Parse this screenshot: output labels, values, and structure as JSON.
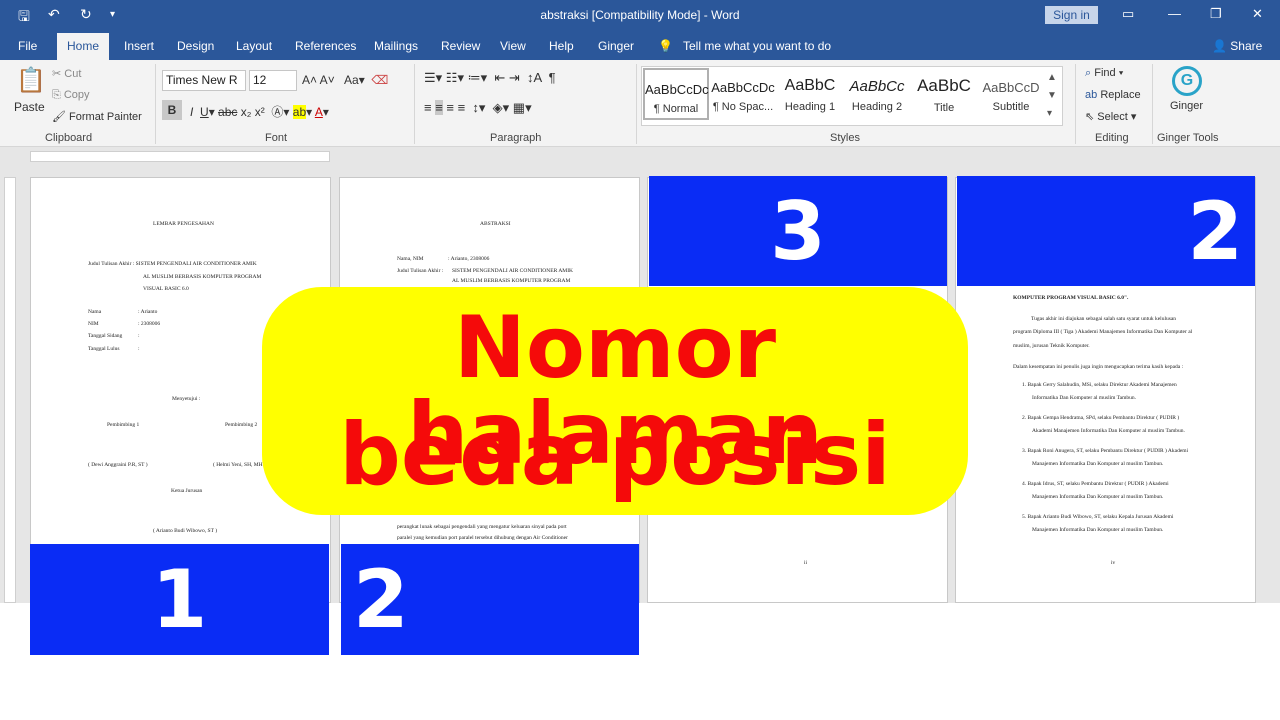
{
  "app": {
    "title": "abstraksi [Compatibility Mode] - Word",
    "signin": "Sign in"
  },
  "tabs": [
    "File",
    "Home",
    "Insert",
    "Design",
    "Layout",
    "References",
    "Mailings",
    "Review",
    "View",
    "Help",
    "Ginger"
  ],
  "tell_me": "Tell me what you want to do",
  "share": "Share",
  "ribbon": {
    "clipboard": {
      "paste": "Paste",
      "cut": "Cut",
      "copy": "Copy",
      "format_painter": "Format Painter",
      "label": "Clipboard"
    },
    "font": {
      "name": "Times New R",
      "size": "12",
      "label": "Font"
    },
    "paragraph": {
      "label": "Paragraph"
    },
    "styles": {
      "items": [
        {
          "preview": "AaBbCcDc",
          "name": "¶ Normal"
        },
        {
          "preview": "AaBbCcDc",
          "name": "¶ No Spac..."
        },
        {
          "preview": "AaBbC",
          "name": "Heading 1"
        },
        {
          "preview": "AaBbCc",
          "name": "Heading 2"
        },
        {
          "preview": "AaBbC",
          "name": "Title"
        },
        {
          "preview": "AaBbCcD",
          "name": "Subtitle"
        }
      ],
      "label": "Styles"
    },
    "editing": {
      "find": "Find",
      "replace": "Replace",
      "select": "Select",
      "label": "Editing"
    },
    "ginger": {
      "name": "Ginger",
      "label": "Ginger Tools"
    }
  },
  "pages": [
    {
      "lines": [
        "LEMBAR PENGESAHAN",
        "Judul Tulisan Akhir : SISTEM PENGENDALI AIR CONDITIONER AMIK",
        "AL MUSLIM BERBASIS KOMPUTER PROGRAM",
        "VISUAL BASIC 6.0",
        "Nama",
        ": Arianto",
        "NIM",
        ": 2308006",
        "Tanggal Sidang",
        ":",
        "Tanggal Lulus",
        ":",
        "Menyetujui :",
        "Pembimbing 1",
        "Pembimbing 2",
        "( Dewi Anggraini P.R, ST )",
        "( Helmi Yeni, SH, MH )",
        "Ketua Jurusan",
        "( Arianto Budi Wibowo, ST )"
      ],
      "number": "1"
    },
    {
      "lines": [
        "ABSTRAKSI",
        "Nama, NIM",
        ": Arianto, 2308006",
        "Judul Tulisan Akhir :",
        "SISTEM PENGENDALI AIR CONDITIONER AMIK",
        "AL MUSLIM BERBASIS KOMPUTER PROGRAM",
        "perangkat lunak sebagai pengendali yang mengatur keluaran sinyal pada port",
        "paralel yang kemudian port paralel tersebut dihubung dengan Air Conditioner"
      ],
      "number": "2"
    },
    {
      "lines": [
        "ii"
      ],
      "number": "3"
    },
    {
      "lines": [
        "KOMPUTER PROGRAM VISUAL BASIC 6.0\".",
        "Tugas akhir ini diajukan sebagai salah satu syarat untuk kelulusan",
        "program Diploma III ( Tiga ) Akademi Manajemen Informatika Dan Komputer al",
        "muslim, jurusan Teknik Komputer.",
        "Dalam kesempatan ini penulis juga ingin mengucapkan terima kasih kepada :",
        "1. Bapak Gerry Salahudin, MSi, selaku Direktur Akademi Manajemen",
        "Informatika Dan Komputer al muslim Tambun.",
        "2. Bapak Gempa Hendratna, SPd, selaku Pembantu Direktur ( PUDIR )",
        "Akademi Manajemen Informatika Dan Komputer al muslim Tambun.",
        "3. Bapak Roni Anugera, ST, selaku Pembantu Direktur ( PUDIR ) Akademi",
        "Manajemen Informatika Dan Komputer al muslim Tambun.",
        "4. Bapak Idrus, ST, selaku Pembantu Direktur ( PUDIR ) Akademi",
        "Manajemen Informatika Dan Komputer al muslim Tambun.",
        "5. Bapak Arianto Budi Wibowo, ST, selaku Kepala Jurusan Akademi",
        "Manajemen Informatika Dan Komputer al muslim Tambun.",
        "iv"
      ],
      "number": "2"
    }
  ],
  "overlay": {
    "line1": "Nomor halaman",
    "line2": "beda posisi",
    "text_color": "#f50a0a",
    "blob_color": "#ffff00",
    "box_color": "#0a2cf5"
  },
  "colors": {
    "word_blue": "#2b579a"
  }
}
